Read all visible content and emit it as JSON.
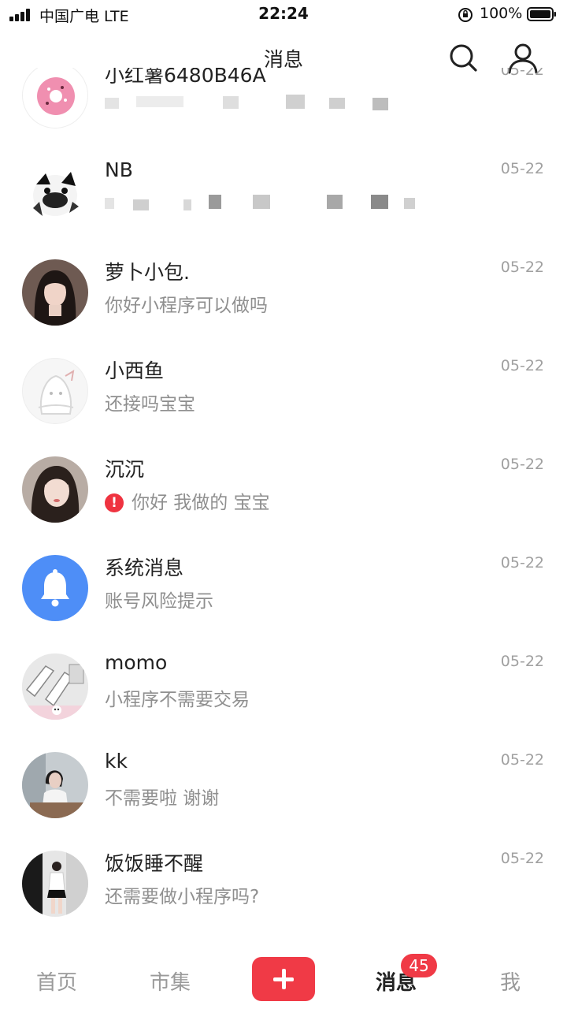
{
  "status_bar": {
    "carrier": "中国广电  LTE",
    "time": "22:24",
    "battery": "100%"
  },
  "header": {
    "title": "消息",
    "search_icon": "search-icon",
    "profile_icon": "user-icon"
  },
  "messages": [
    {
      "name": "小红薯6480B46A",
      "preview": "",
      "date": "05-22",
      "avatar": "donut"
    },
    {
      "name": "NB",
      "preview": "",
      "date": "05-22",
      "avatar": "dog"
    },
    {
      "name": "萝卜小包.",
      "preview": "你好小程序可以做吗",
      "date": "05-22",
      "avatar": "photo"
    },
    {
      "name": "小西鱼",
      "preview": "还接吗宝宝",
      "date": "05-22",
      "avatar": "default"
    },
    {
      "name": "沉沉",
      "preview": "你好 我做的 宝宝",
      "date": "05-22",
      "avatar": "photo",
      "warning_icon": "alert-icon"
    },
    {
      "name": "系统消息",
      "preview": "账号风险提示",
      "date": "05-22",
      "avatar": "bell"
    },
    {
      "name": "momo",
      "preview": "小程序不需要交易",
      "date": "05-22",
      "avatar": "sketch"
    },
    {
      "name": "kk",
      "preview": "不需要啦 谢谢",
      "date": "05-22",
      "avatar": "photo"
    },
    {
      "name": "饭饭睡不醒",
      "preview": "还需要做小程序吗?",
      "date": "05-22",
      "avatar": "photo"
    }
  ],
  "tabbar": {
    "home": "首页",
    "market": "市集",
    "post_icon": "plus-icon",
    "messages": "消息",
    "messages_badge": "45",
    "me": "我"
  },
  "colors": {
    "accent": "#f03a46",
    "system_avatar": "#4e8ef7",
    "secondary_text": "#8f8f8f",
    "date_text": "#a0a0a0"
  }
}
